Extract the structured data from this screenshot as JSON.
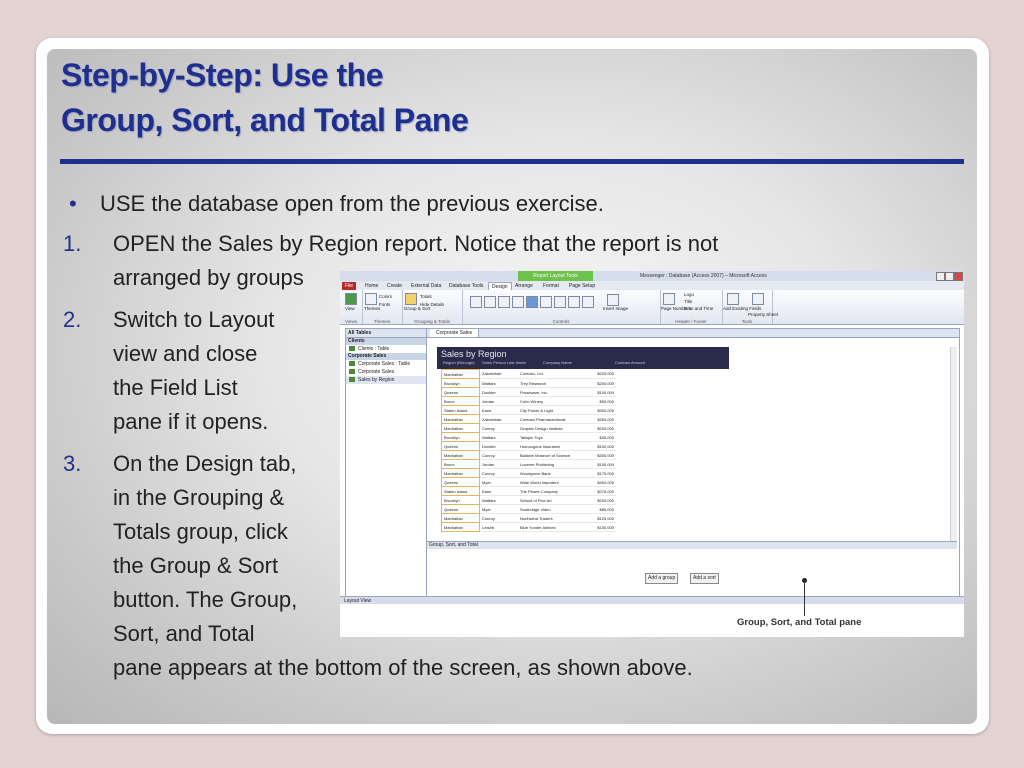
{
  "slide": {
    "title_line1": "Step-by-Step: Use the",
    "title_line2": "Group, Sort, and Total Pane",
    "bullet_char": "•",
    "bullet_kw": "USE",
    "bullet_rest": " the database open from the previous exercise.",
    "step1_num": "1.",
    "step1_kw": "OPEN",
    "step1_mid": " the ",
    "step1_obj": "Sales by Region",
    "step1_rest": " report. Notice that the report is not",
    "step1_line2": "arranged by groups",
    "step2_num": "2.",
    "step2_lines": [
      "Switch to Layout",
      "view and close",
      "the Field List",
      "pane if it opens."
    ],
    "step3_num": "3.",
    "step3_lines": [
      "On the Design tab,",
      "in the Grouping &",
      "Totals group, click"
    ],
    "step3_the": "the ",
    "step3_obj": "Group & Sort",
    "step3_lines_b": [
      "button. The Group,",
      "Sort, and Total"
    ],
    "step3_last": "pane appears at the bottom of the screen, as shown above."
  },
  "screenshot": {
    "context_tab": "Report Layout Tools",
    "window_title": "Messenger : Database (Access 2007) – Microsoft Access",
    "tabs": [
      "File",
      "Home",
      "Create",
      "External Data",
      "Database Tools",
      "Design",
      "Arrange",
      "Format",
      "Page Setup"
    ],
    "ribbon_groups": [
      "Views",
      "Themes",
      "Grouping & Totals",
      "Controls",
      "Header / Footer",
      "Tools"
    ],
    "ribbon_labels": {
      "view": "View",
      "themes": "Themes",
      "colors": "Colors",
      "fonts": "Fonts",
      "group_sort": "Group & Sort",
      "totals": "Totals",
      "hide_details": "Hide Details",
      "insert_image": "Insert Image",
      "page_numbers": "Page Numbers",
      "logo": "Logo",
      "title": "Title",
      "date_time": "Date and Time",
      "add_fields": "Add Existing Fields",
      "property_sheet": "Property Sheet"
    },
    "nav_header": "All Tables",
    "nav_sections": [
      {
        "name": "Clients",
        "items": [
          "Clients : Table"
        ]
      },
      {
        "name": "Corporate Sales",
        "items": [
          "Corporate Sales : Table",
          "Corporate Sales",
          "Sales by Region"
        ]
      }
    ],
    "doc_tab": "Corporate Sales",
    "report_title": "Sales by Region",
    "columns": [
      "Region (Borough)",
      "Sales Person Last Name",
      "Company Name",
      "Contract Amount"
    ],
    "rows": [
      [
        "Manhattan",
        "Zabokritski",
        "Contoso, Ltd.",
        "$225,000"
      ],
      [
        "Brooklyn",
        "Wattars",
        "Trey Research",
        "$200,000"
      ],
      [
        "Queens",
        "Dockter",
        "Proseware, Inc.",
        "$100,000"
      ],
      [
        "Bronx",
        "Jordan",
        "Coho Winery",
        "$50,000"
      ],
      [
        "Staten Island",
        "Kane",
        "City Power & Light",
        "$300,000"
      ],
      [
        "Manhattan",
        "Zabokritski",
        "Contoso Pharmaceuticals",
        "$350,000"
      ],
      [
        "Manhattan",
        "Conroy",
        "Graphic Design Institute",
        "$200,000"
      ],
      [
        "Brooklyn",
        "Wattars",
        "Tailspin Toys",
        "$35,000"
      ],
      [
        "Queens",
        "Dockter",
        "Humongous Insurance",
        "$150,000"
      ],
      [
        "Manhattan",
        "Conroy",
        "Baldwin Museum of Science",
        "$300,000"
      ],
      [
        "Bronx",
        "Jordan",
        "Lucerne Publishing",
        "$150,000"
      ],
      [
        "Manhattan",
        "Conroy",
        "Woodgrove Bank",
        "$175,000"
      ],
      [
        "Queens",
        "Myer",
        "Wide World Importers",
        "$400,000"
      ],
      [
        "Staten Island",
        "Kane",
        "The Phone Company",
        "$275,000"
      ],
      [
        "Brooklyn",
        "Wattars",
        "School of Fine Art",
        "$200,000"
      ],
      [
        "Queens",
        "Myer",
        "Southridge Video",
        "$85,000"
      ],
      [
        "Manhattan",
        "Conroy",
        "Northwind Traders",
        "$125,000"
      ],
      [
        "Manhattan",
        "Leavitt",
        "Blue Yonder Airlines",
        "$150,000"
      ]
    ],
    "gst_header": "Group, Sort, and Total",
    "add_group": "Add a group",
    "add_sort": "Add a sort",
    "status": "Layout View",
    "callout": "Group, Sort, and Total pane"
  },
  "colors": {
    "title": "#1f2f8f",
    "context_tab": "#6cc24a",
    "file_tab": "#b72b2b",
    "report_header": "#2a2a4a"
  }
}
